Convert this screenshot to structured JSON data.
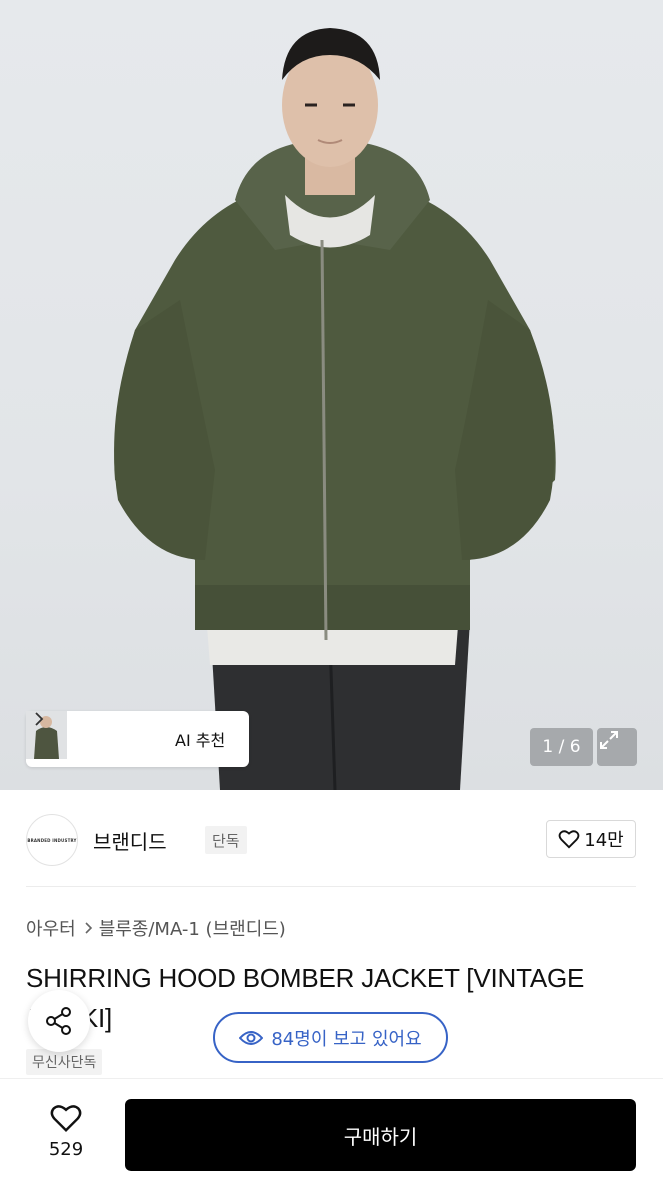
{
  "gallery": {
    "counter": "1 / 6",
    "ai_recommend_label": "AI 추천",
    "thumbnails": [
      "khaki-jacket-thumb",
      "grey-jacket-thumb",
      "model-thumb"
    ]
  },
  "brand": {
    "logo_text": "BRANDED INDUSTRY",
    "name": "브랜디드",
    "badge": "단독",
    "like_count": "14만"
  },
  "breadcrumb": {
    "category": "아우터",
    "subcategory": "블루종/MA-1 (브랜디드)"
  },
  "product": {
    "title_line1": "SHIRRING HOOD BOMBER JACKET [VINTAGE",
    "title_line2": "KHAKI]",
    "exclusive_tag": "무신사단독"
  },
  "viewers": {
    "text": "84명이 보고 있어요"
  },
  "bottom_bar": {
    "wish_count": "529",
    "buy_label": "구매하기"
  },
  "colors": {
    "accent_blue": "#3763c6",
    "buy_button": "#000000",
    "jacket_khaki": "#4f5a3f"
  }
}
